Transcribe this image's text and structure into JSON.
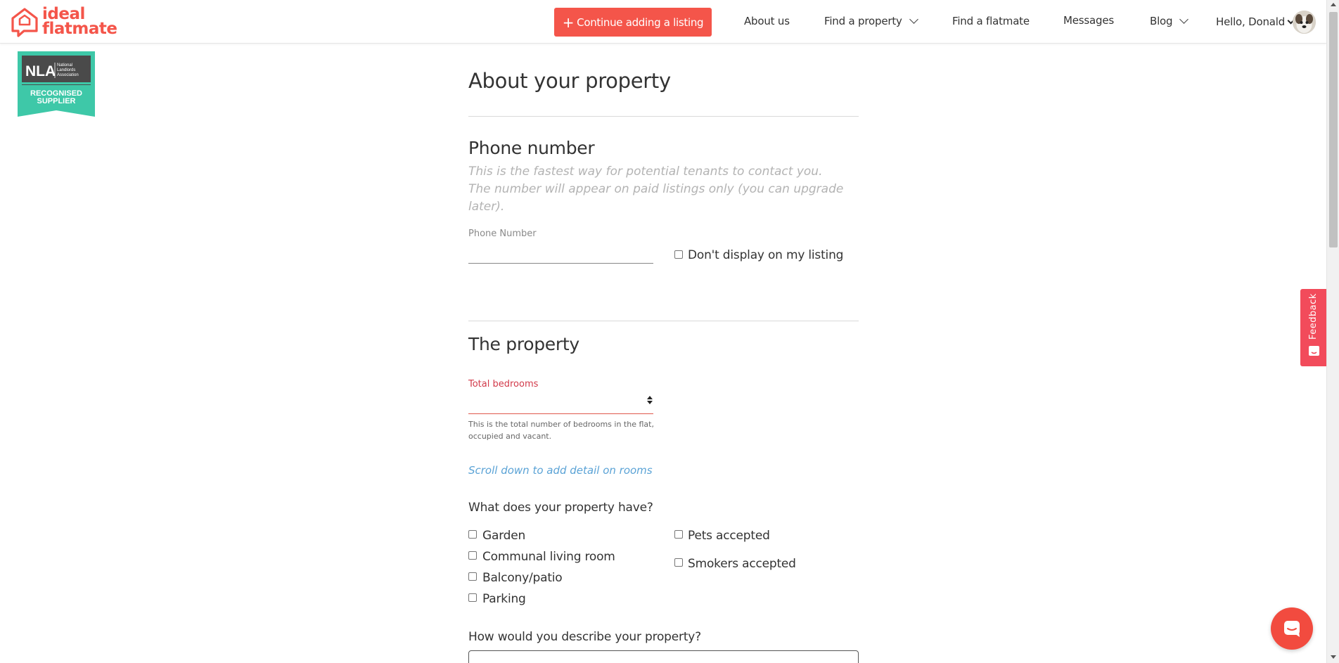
{
  "header": {
    "logo_line1": "ideal",
    "logo_line2": "flatmate",
    "cta_label": "Continue adding a listing",
    "nav": {
      "about": "About us",
      "find_property": "Find a property",
      "find_flatmate": "Find a flatmate",
      "messages": "Messages",
      "blog": "Blog",
      "greeting": "Hello, Donald"
    }
  },
  "badge": {
    "org_short": "NLA",
    "org_full": "National Landlords Association",
    "line1": "RECOGNISED",
    "line2": "SUPPLIER"
  },
  "form": {
    "title": "About your property",
    "phone_section": {
      "heading": "Phone number",
      "hint": "This is the fastest way for potential tenants to contact you. The number will appear on paid listings only (you can upgrade later).",
      "field_label": "Phone Number",
      "field_value": "",
      "dont_display_label": "Don't display on my listing"
    },
    "property_section": {
      "heading": "The property",
      "bedrooms_label": "Total bedrooms",
      "bedrooms_value": "",
      "bedrooms_helper": "This is the total number of bedrooms in the flat, occupied and vacant.",
      "scroll_link": "Scroll down to add detail on rooms",
      "amenities_question": "What does your property have?",
      "amenities_left": [
        "Garden",
        "Communal living room",
        "Balcony/patio",
        "Parking"
      ],
      "amenities_right": [
        "Pets accepted",
        "Smokers accepted"
      ],
      "describe_question": "How would you describe your property?"
    }
  },
  "feedback_tab": {
    "label": "Feedback"
  },
  "colors": {
    "brand": "#f4554a",
    "badge_teal": "#3ec8a8",
    "badge_dark": "#4a4a4a",
    "feedback": "#f24b5b",
    "link": "#5ba3d6",
    "error_label": "#d23a4a"
  }
}
